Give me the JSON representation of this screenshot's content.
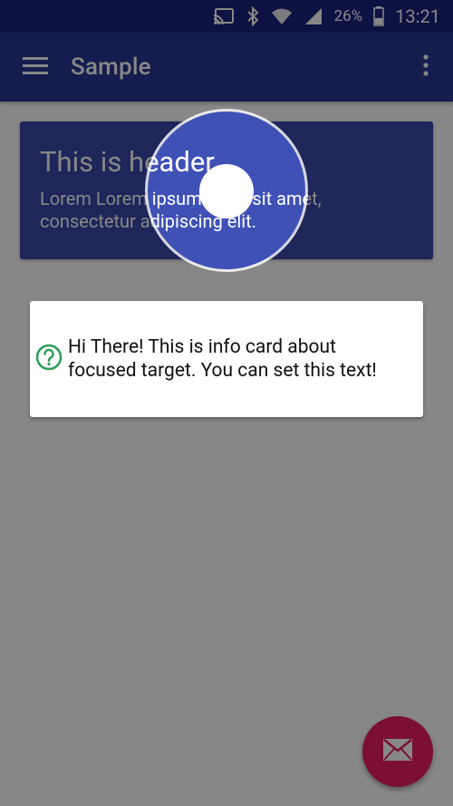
{
  "status_bar": {
    "battery": "26%",
    "time": "13:21"
  },
  "app_bar": {
    "title": "Sample",
    "menu_icon": "hamburger-menu-icon",
    "overflow_icon": "more-vert-icon"
  },
  "header_card": {
    "title": "This is header",
    "body": "Lorem Lorem ipsum dolor sit amet, consectetur adipiscing elit."
  },
  "info_card": {
    "icon": "help-circle-icon",
    "text": "Hi There! This is info card about focused target. You can set this text!"
  },
  "fab": {
    "icon": "mail-icon"
  },
  "colors": {
    "status_bar": "#1a237e",
    "app_bar": "#283593",
    "card": "#3949ab",
    "spot": "#3f51b5",
    "fab": "#e91e63",
    "info_icon": "#2e9d5a"
  }
}
